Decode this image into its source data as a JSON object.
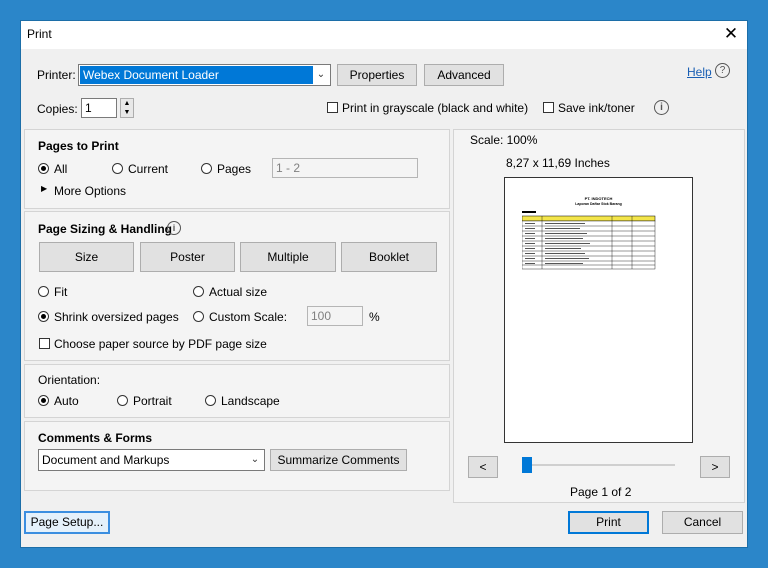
{
  "window": {
    "title": "Print",
    "close_glyph": "✕"
  },
  "printer": {
    "label": "Printer:",
    "selected": "Webex Document Loader",
    "properties_label": "Properties",
    "advanced_label": "Advanced",
    "help_label": "Help"
  },
  "copies": {
    "label": "Copies:",
    "value": "1",
    "grayscale_label": "Print in grayscale (black and white)",
    "grayscale_checked": false,
    "save_ink_label": "Save ink/toner",
    "save_ink_checked": false
  },
  "pages_to_print": {
    "title": "Pages to Print",
    "all_label": "All",
    "current_label": "Current",
    "pages_label": "Pages",
    "pages_range": "1 - 2",
    "selected": "all",
    "more_options_label": "More Options"
  },
  "sizing": {
    "title": "Page Sizing & Handling",
    "tabs": [
      "Size",
      "Poster",
      "Multiple",
      "Booklet"
    ],
    "fit_label": "Fit",
    "actual_size_label": "Actual size",
    "shrink_label": "Shrink oversized pages",
    "custom_scale_label": "Custom Scale:",
    "custom_scale_value": "100",
    "percent_symbol": "%",
    "selected": "shrink",
    "paper_source_label": "Choose paper source by PDF page size"
  },
  "orientation": {
    "title": "Orientation:",
    "auto_label": "Auto",
    "portrait_label": "Portrait",
    "landscape_label": "Landscape",
    "selected": "auto"
  },
  "comments_forms": {
    "title": "Comments & Forms",
    "selected": "Document and Markups",
    "summarize_label": "Summarize Comments"
  },
  "preview": {
    "scale_text": "Scale: 100%",
    "dimensions": "8,27 x 11,69 Inches",
    "prev_glyph": "<",
    "next_glyph": ">",
    "page_indicator": "Page 1 of 2",
    "doc_title": "PT. INDOTECH",
    "doc_subtitle": "Laporan Daftar Stok Barang"
  },
  "footer": {
    "page_setup_label": "Page Setup...",
    "print_label": "Print",
    "cancel_label": "Cancel"
  }
}
